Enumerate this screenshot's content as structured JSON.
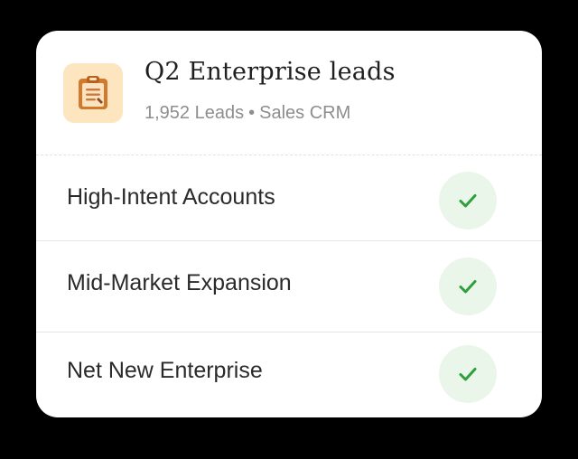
{
  "header": {
    "title": "Q2 Enterprise leads",
    "lead_count": "1,952 Leads",
    "separator": "•",
    "source": "Sales CRM",
    "icon": "clipboard-icon"
  },
  "segments": [
    {
      "label": "High-Intent Accounts",
      "status_icon": "check-icon",
      "checked": true
    },
    {
      "label": "Mid-Market Expansion",
      "status_icon": "check-icon",
      "checked": true
    },
    {
      "label": "Net New Enterprise",
      "status_icon": "check-icon",
      "checked": true
    }
  ],
  "colors": {
    "background": "#000000",
    "card": "#ffffff",
    "icon_tile": "#fde6bf",
    "check_bg": "#eaf6ea",
    "check_mark": "#2e9e3e",
    "subtitle": "#8e8e8e"
  }
}
